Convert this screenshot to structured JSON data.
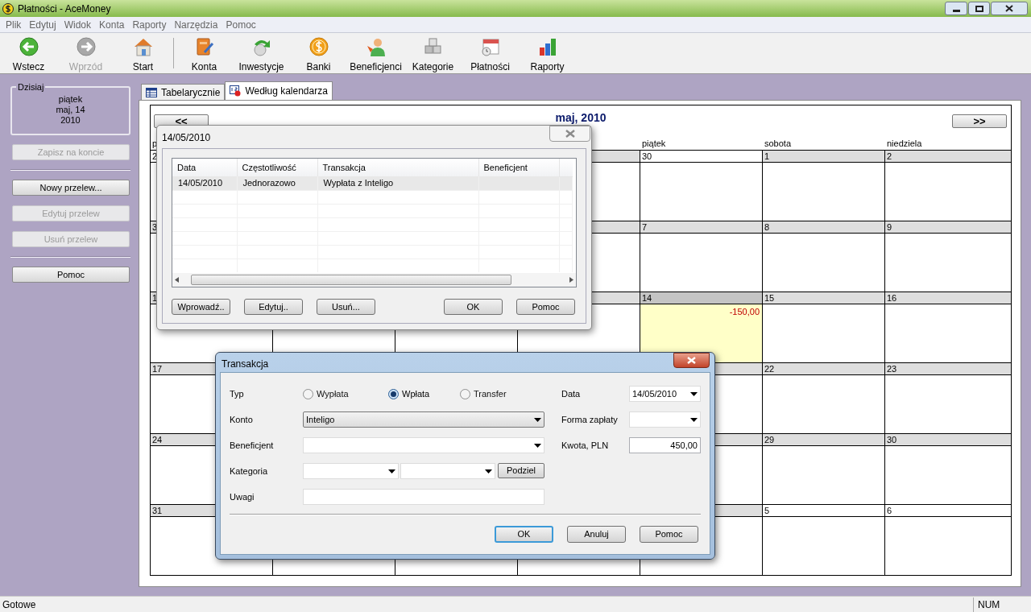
{
  "window": {
    "title": "Płatności - AceMoney"
  },
  "menu": [
    "Plik",
    "Edytuj",
    "Widok",
    "Konta",
    "Raporty",
    "Narzędzia",
    "Pomoc"
  ],
  "toolbar": [
    [
      {
        "label": "Wstecz",
        "kind": "back",
        "disabled": false
      },
      {
        "label": "Wprzód",
        "kind": "forward",
        "disabled": true
      },
      {
        "label": "Start",
        "kind": "home",
        "disabled": false
      }
    ],
    [
      {
        "label": "Konta",
        "kind": "book",
        "disabled": false
      },
      {
        "label": "Inwestycje",
        "kind": "invest",
        "disabled": false
      },
      {
        "label": "Banki",
        "kind": "coin",
        "disabled": false
      },
      {
        "label": "Beneficjenci",
        "kind": "person",
        "disabled": false
      },
      {
        "label": "Kategorie",
        "kind": "boxes",
        "disabled": false
      },
      {
        "label": "Płatności",
        "kind": "calendar",
        "disabled": false
      },
      {
        "label": "Raporty",
        "kind": "chart",
        "disabled": false
      }
    ]
  ],
  "sidebar": {
    "today": {
      "legend": "Dzisiaj",
      "lines": [
        "piątek",
        "maj, 14",
        "2010"
      ]
    },
    "button_groups": [
      [
        {
          "label": "Zapisz na koncie",
          "disabled": true
        }
      ],
      [
        {
          "label": "Nowy przelew...",
          "disabled": false
        },
        {
          "label": "Edytuj przelew",
          "disabled": true
        },
        {
          "label": "Usuń przelew",
          "disabled": true
        }
      ],
      [
        {
          "label": "Pomoc",
          "disabled": false
        }
      ]
    ]
  },
  "tabs": [
    {
      "label": "Tabelarycznie",
      "kind": "table",
      "selected": false
    },
    {
      "label": "Według kalendarza",
      "kind": "calendar",
      "selected": true
    }
  ],
  "calendar": {
    "title": "maj, 2010",
    "prev": "<<",
    "next": ">>",
    "weekdays": {
      "start": [
        "p"
      ],
      "end": [
        "piątek",
        "sobota",
        "niedziela"
      ]
    },
    "weeks": [
      {
        "start": [
          {
            "day": "2",
            "other_month": true,
            "today": false
          }
        ],
        "end": [
          {
            "day": "30",
            "other_month": true,
            "today": false
          },
          {
            "day": "1",
            "other_month": false,
            "today": false
          },
          {
            "day": "2",
            "other_month": false,
            "today": false
          }
        ]
      },
      {
        "start": [
          {
            "day": "3",
            "other_month": false,
            "today": false
          }
        ],
        "end": [
          {
            "day": "7",
            "other_month": false,
            "today": false
          },
          {
            "day": "8",
            "other_month": false,
            "today": false
          },
          {
            "day": "9",
            "other_month": false,
            "today": false
          }
        ]
      },
      {
        "start": [
          {
            "day": "1",
            "other_month": false,
            "today": false
          }
        ],
        "end": [
          {
            "day": "14",
            "other_month": false,
            "today": true,
            "amount": "-150,00"
          },
          {
            "day": "15",
            "other_month": false,
            "today": false
          },
          {
            "day": "16",
            "other_month": false,
            "today": false
          }
        ]
      },
      {
        "start": [
          {
            "day": "17",
            "other_month": false,
            "today": false
          }
        ],
        "end": [
          {
            "day": "22",
            "other_month": false,
            "today": false
          },
          {
            "day": "23",
            "other_month": false,
            "today": false
          }
        ]
      },
      {
        "start": [
          {
            "day": "24",
            "other_month": false,
            "today": false
          }
        ],
        "end": [
          {
            "day": "29",
            "other_month": false,
            "today": false
          },
          {
            "day": "30",
            "other_month": false,
            "today": false
          }
        ]
      },
      {
        "start": [
          {
            "day": "31",
            "other_month": false,
            "today": false
          }
        ],
        "end": [
          {
            "day": "5",
            "other_month": true,
            "today": false
          },
          {
            "day": "6",
            "other_month": true,
            "today": false
          }
        ]
      }
    ]
  },
  "day_dialog": {
    "title": "14/05/2010",
    "columns": [
      "Data",
      "Częstotliwość",
      "Transakcja",
      "Beneficjent"
    ],
    "rows": [
      {
        "cells": [
          "14/05/2010",
          "Jednorazowo",
          "Wypłata z Inteligo"
        ],
        "selected": true
      }
    ],
    "buttons": [
      "Wprowadź..",
      "Edytuj..",
      "Usuń...",
      "OK",
      "Pomoc"
    ]
  },
  "transaction_dialog": {
    "title": "Transakcja",
    "fields": [
      {
        "label": "Typ",
        "kind": "radios",
        "options": [
          {
            "label": "Wypłata",
            "selected": false
          },
          {
            "label": "Wpłata",
            "selected": true
          },
          {
            "label": "Transfer",
            "selected": false
          }
        ]
      },
      {
        "label": "Konto",
        "kind": "dropdown",
        "value": "Inteligo"
      },
      {
        "label": "Beneficjent",
        "kind": "combo"
      },
      {
        "label": "Kategoria",
        "kind": "split",
        "button": "Podziel"
      },
      {
        "label": "Uwagi",
        "kind": "text"
      }
    ],
    "right_fields": [
      {
        "label": "Data",
        "kind": "combo",
        "value": "14/05/2010"
      },
      {
        "label": "Forma zapłaty",
        "kind": "combo"
      },
      {
        "label": "Kwota, PLN",
        "kind": "text",
        "value": "450,00"
      }
    ],
    "buttons": [
      {
        "label": "OK",
        "default": true
      },
      {
        "label": "Anuluj",
        "default": false
      },
      {
        "label": "Pomoc",
        "default": false
      }
    ]
  },
  "status_bar": {
    "text": "Gotowe",
    "indicators": [
      "NUM"
    ]
  }
}
